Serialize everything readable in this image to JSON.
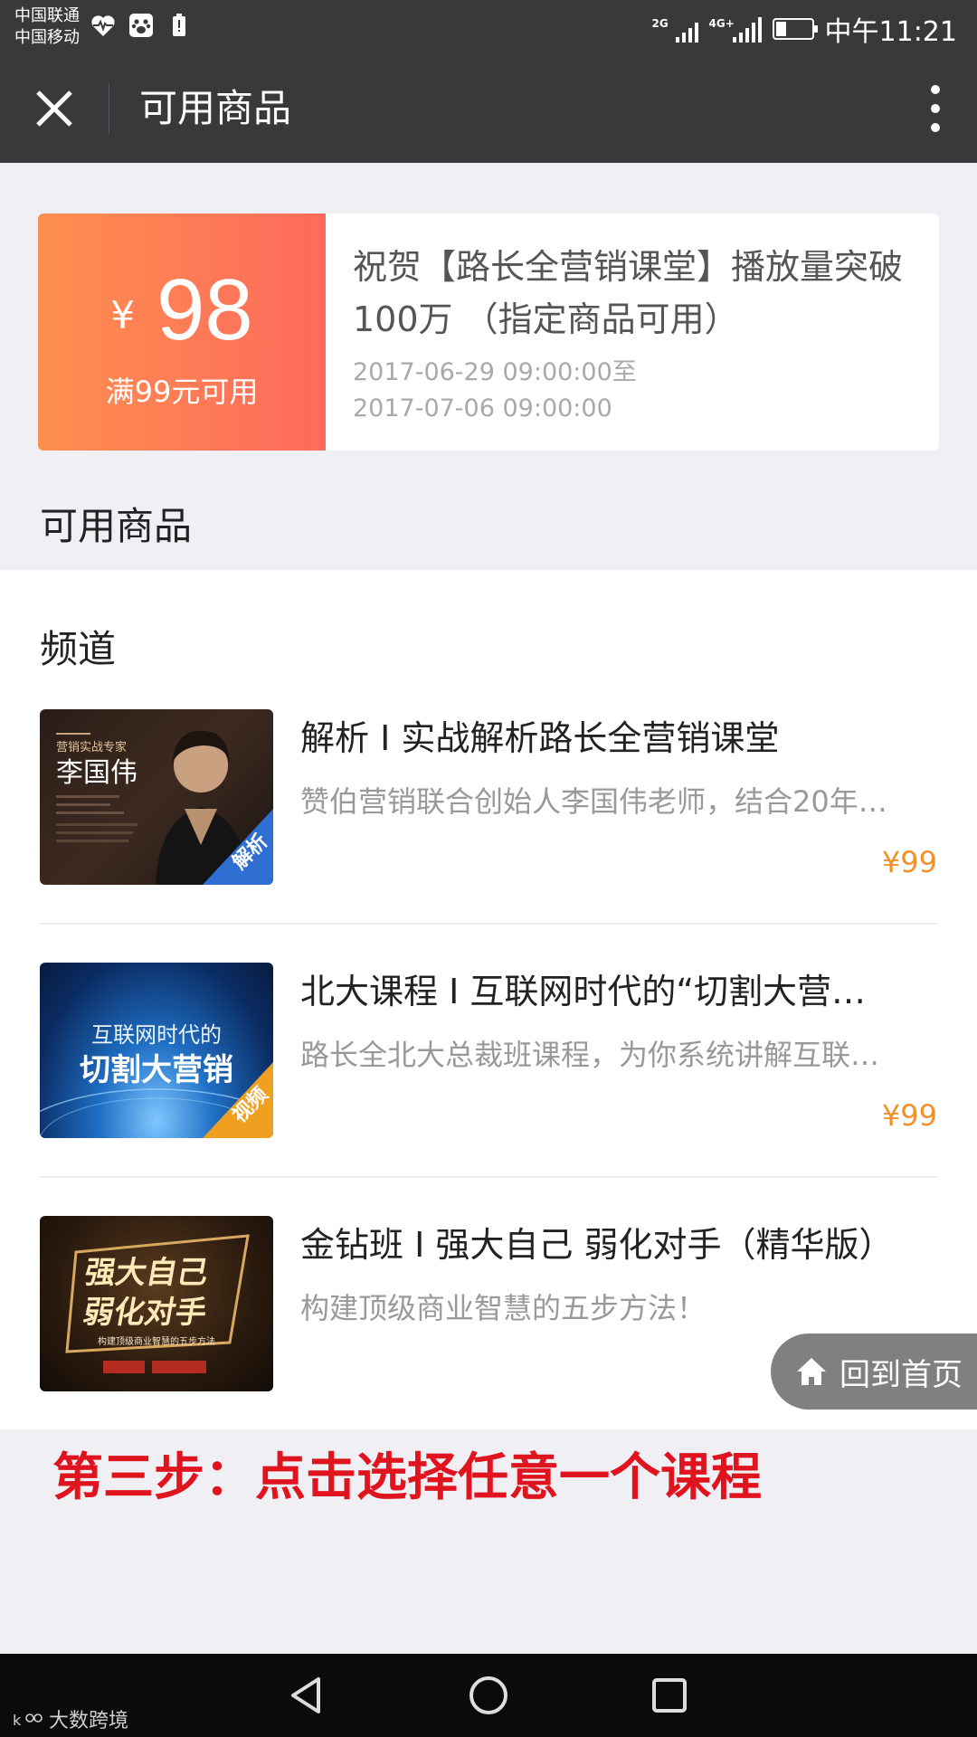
{
  "status_bar": {
    "carrier_1": "中国联通",
    "carrier_2": "中国移动",
    "signal_1_label": "2G",
    "signal_2_label": "4G+",
    "time": "中午11:21",
    "icons": [
      "heart-rate-icon",
      "baidu-paw-icon",
      "battery-alert-icon"
    ]
  },
  "navbar": {
    "title": "可用商品",
    "close_icon": "close-icon",
    "more_icon": "more-vertical-icon"
  },
  "coupon": {
    "currency": "¥",
    "amount": "98",
    "condition": "满99元可用",
    "title": "祝贺【路长全营销课堂】播放量突破100万 （指定商品可用）",
    "valid_from": "2017-06-29 09:00:00至",
    "valid_to": "2017-07-06 09:00:00",
    "colors": {
      "gradient_start": "#fe8f4f",
      "gradient_end": "#fd6a5c"
    }
  },
  "section_label": "可用商品",
  "channel_label": "频道",
  "items": [
    {
      "title": "解析 I 实战解析路长全营销课堂",
      "desc": "赞伯营销联合创始人李国伟老师，结合20年…",
      "price": "¥99",
      "thumb": {
        "kicker": "营销实战专家",
        "name": "李国伟",
        "badge": "解析",
        "badge_color": "#2f6fd1"
      }
    },
    {
      "title": "北大课程 I 互联网时代的“切割大营…",
      "desc": "路长全北大总裁班课程，为你系统讲解互联…",
      "price": "¥99",
      "thumb": {
        "line1": "互联网时代的",
        "line2": "切割大营销",
        "badge": "视频",
        "badge_color": "#f0a020"
      }
    },
    {
      "title": "金钻班 I 强大自己 弱化对手（精华版）",
      "desc": "构建顶级商业智慧的五步方法！",
      "price": "",
      "thumb": {
        "line1": "强大自己",
        "line2": "弱化对手",
        "sub": "构建顶级商业智慧的五步方法"
      }
    }
  ],
  "home_button": {
    "label": "回到首页",
    "icon": "home-icon"
  },
  "step_note": "第三步：点击选择任意一个课程",
  "watermark": "大数跨境",
  "system_nav": [
    "back-icon",
    "home-circle-icon",
    "recents-icon"
  ],
  "accent_colors": {
    "price": "#f0912c",
    "step_note": "#e0141e",
    "bar": "#39393c"
  }
}
